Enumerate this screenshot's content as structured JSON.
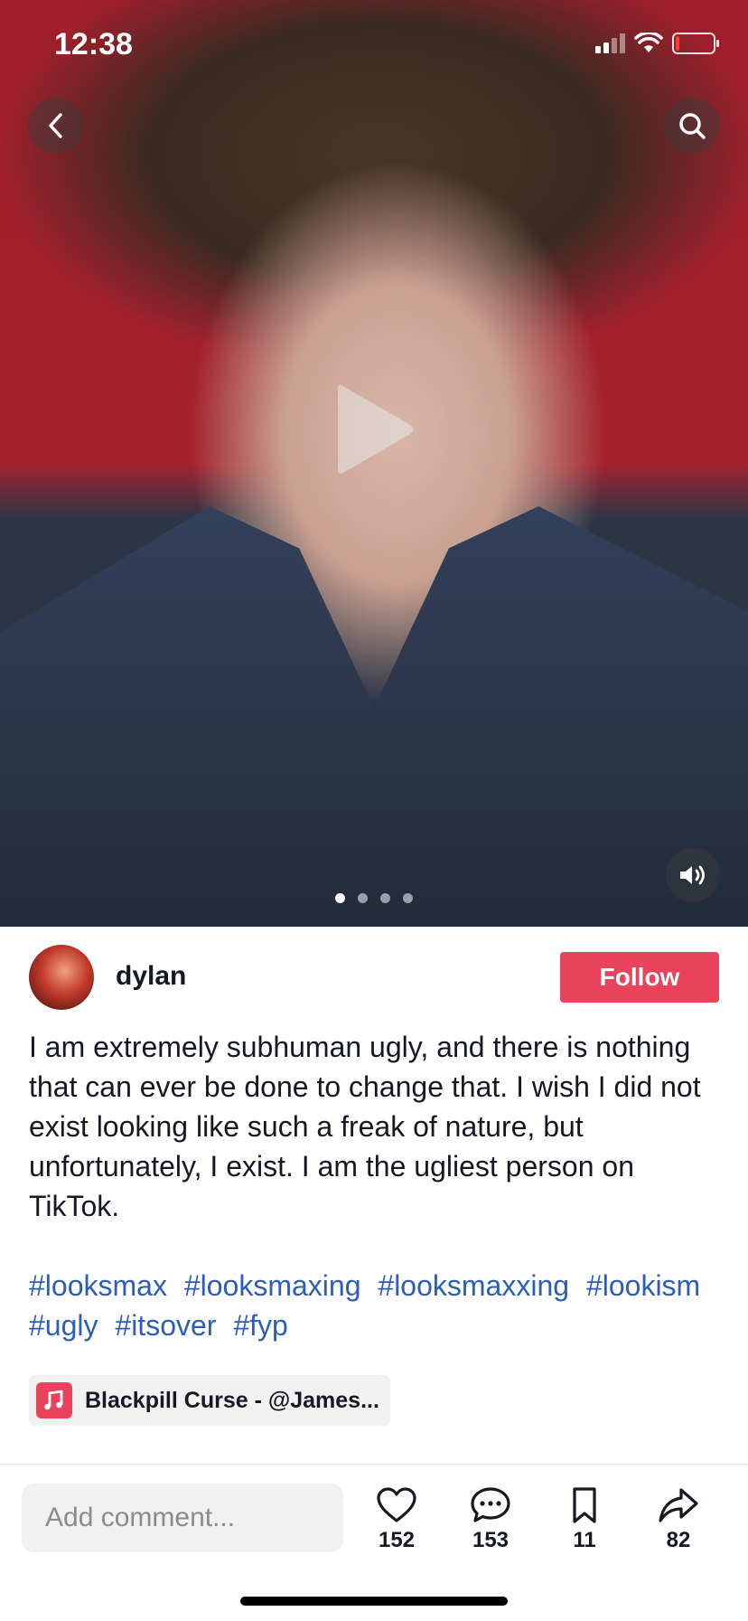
{
  "status_bar": {
    "time": "12:38"
  },
  "media": {
    "carousel_count": 4,
    "carousel_active_index": 0
  },
  "author": {
    "name": "dylan",
    "follow_label": "Follow"
  },
  "caption": "I am extremely subhuman ugly, and there is nothing that can ever be done to change that. I wish I did not exist looking like such a freak of nature, but unfortunately, I exist. I am the ugliest person on TikTok.",
  "hashtags": [
    "#looksmax",
    "#looksmaxing",
    "#looksmaxxing",
    "#lookism",
    "#ugly",
    "#itsover",
    "#fyp"
  ],
  "music": {
    "label": "Blackpill Curse - @James..."
  },
  "comment": {
    "placeholder": "Add comment..."
  },
  "actions": {
    "likes": "152",
    "comments": "153",
    "saves": "11",
    "shares": "82"
  },
  "colors": {
    "accent": "#e9435b",
    "hashtag": "#2b5db9"
  }
}
